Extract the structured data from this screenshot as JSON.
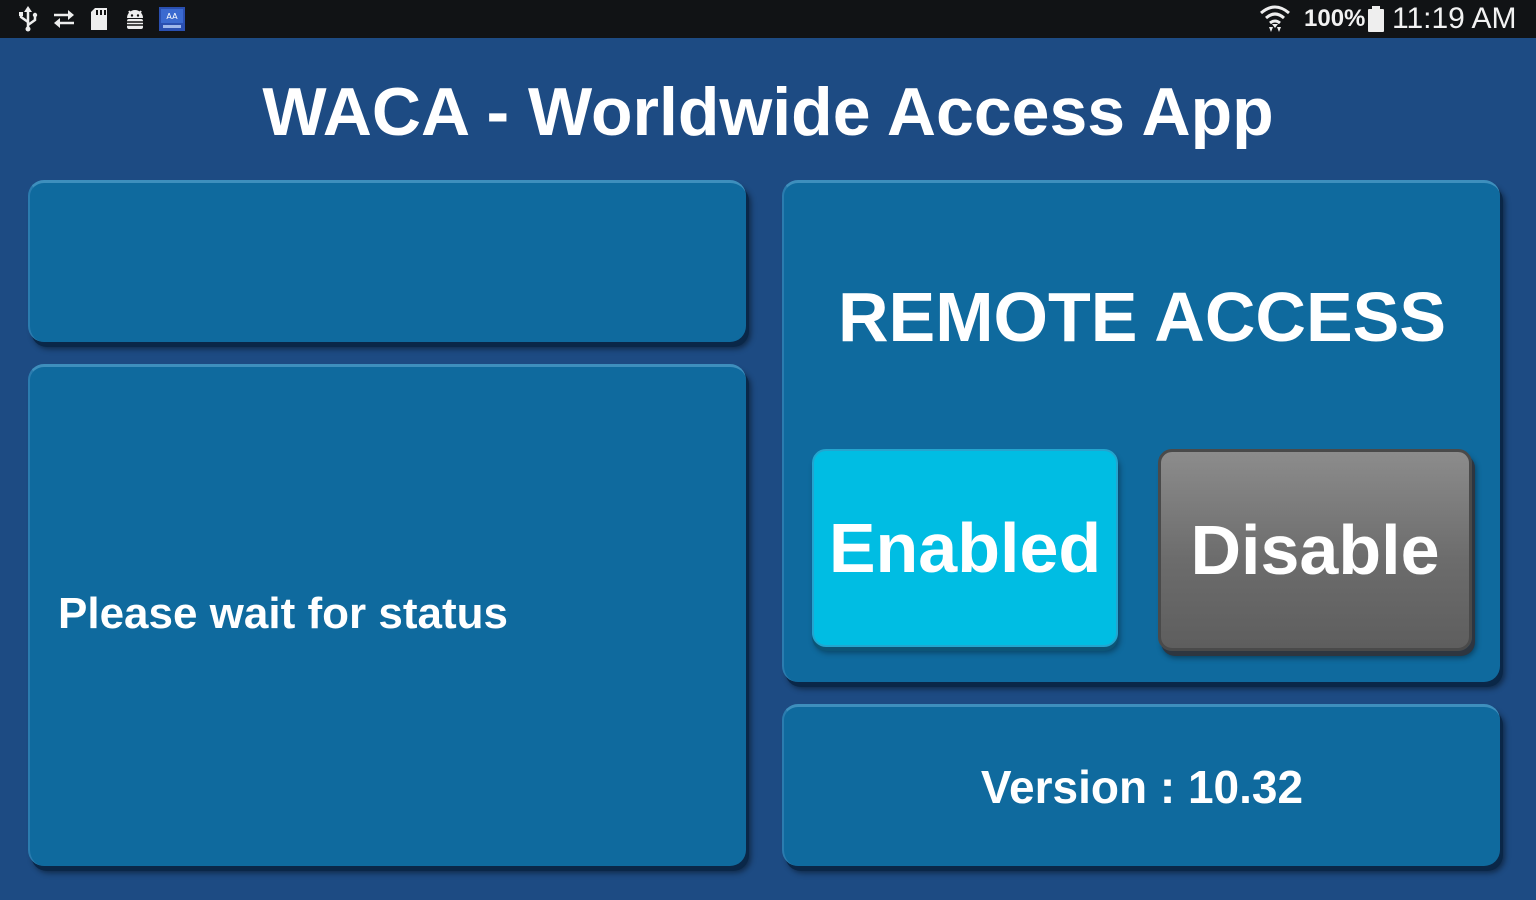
{
  "status_bar": {
    "icons_left": [
      "usb-icon",
      "sync-icon",
      "sd-card-icon",
      "android-debug-icon",
      "app-notification-icon"
    ],
    "icons_right": [
      "wifi-icon",
      "battery-icon"
    ],
    "battery_percent": "100%",
    "time": "11:19 AM"
  },
  "app": {
    "title": "WACA - Worldwide Access App"
  },
  "left": {
    "top_panel_text": "",
    "status_message": "Please wait for status"
  },
  "remote_access": {
    "title": "REMOTE ACCESS",
    "enabled_label": "Enabled",
    "disable_label": "Disable"
  },
  "version": {
    "label": "Version : 10.32"
  },
  "colors": {
    "background": "#1d4b83",
    "panel": "#0f6a9e",
    "enabled_button": "#00bde3",
    "disable_button": "#6c6c6c",
    "status_bar": "#111315"
  }
}
